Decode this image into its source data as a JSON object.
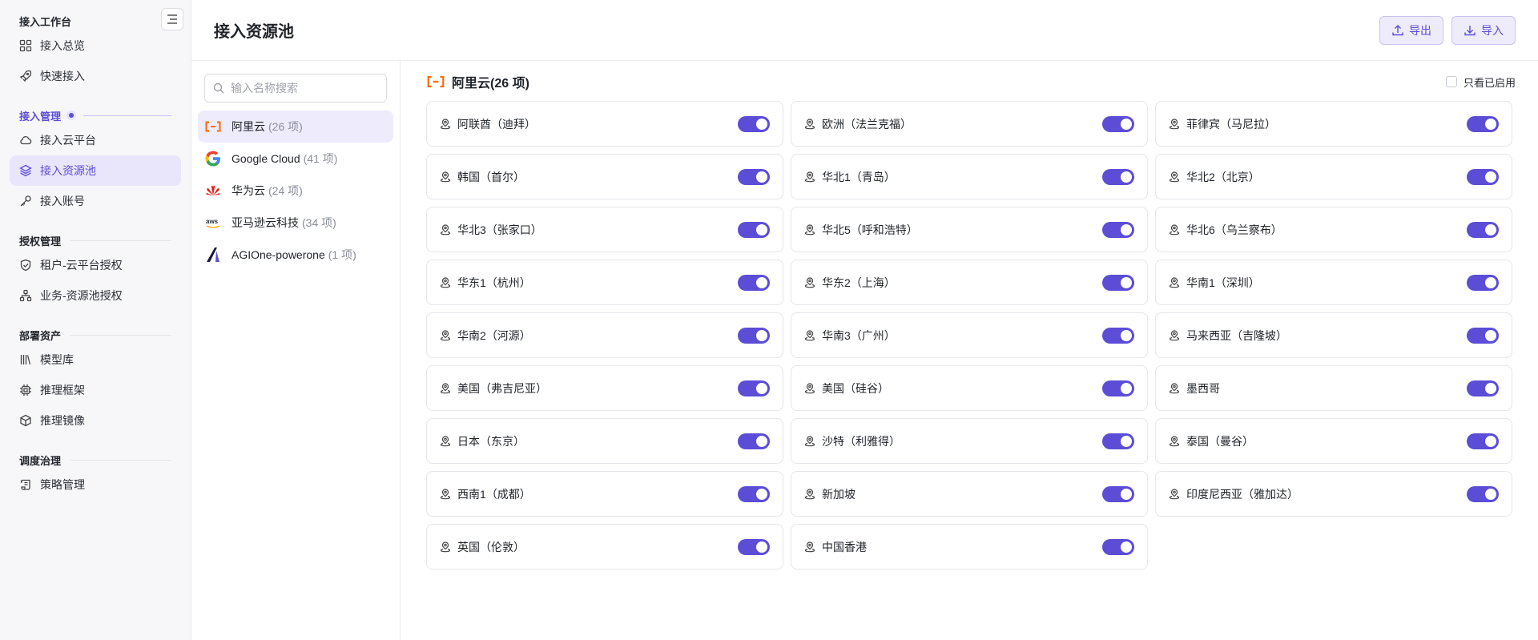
{
  "sidebar": {
    "groups": [
      {
        "title": "接入工作台",
        "items": [
          "接入总览",
          "快速接入"
        ]
      },
      {
        "title": "接入管理",
        "items": [
          "接入云平台",
          "接入资源池",
          "接入账号"
        ]
      },
      {
        "title": "授权管理",
        "items": [
          "租户-云平台授权",
          "业务-资源池授权"
        ]
      },
      {
        "title": "部署资产",
        "items": [
          "模型库",
          "推理框架",
          "推理镜像"
        ]
      },
      {
        "title": "调度治理",
        "items": [
          "策略管理"
        ]
      }
    ]
  },
  "header": {
    "title": "接入资源池",
    "export_label": "导出",
    "import_label": "导入"
  },
  "pool_list": {
    "search_placeholder": "输入名称搜索",
    "pools": [
      {
        "name": "阿里云",
        "count": "(26 项)"
      },
      {
        "name": "Google Cloud",
        "count": "(41 项)"
      },
      {
        "name": "华为云",
        "count": "(24 项)"
      },
      {
        "name": "亚马逊云科技",
        "count": "(34 项)"
      },
      {
        "name": "AGIOne-powerone",
        "count": "(1 项)"
      }
    ]
  },
  "regions": {
    "title": "阿里云(26 项)",
    "only_enabled_label": "只看已启用",
    "items": [
      "阿联酋（迪拜）",
      "欧洲（法兰克福）",
      "菲律宾（马尼拉）",
      "韩国（首尔）",
      "华北1（青岛）",
      "华北2（北京）",
      "华北3（张家口）",
      "华北5（呼和浩特）",
      "华北6（乌兰察布）",
      "华东1（杭州）",
      "华东2（上海）",
      "华南1（深圳）",
      "华南2（河源）",
      "华南3（广州）",
      "马来西亚（吉隆坡）",
      "美国（弗吉尼亚）",
      "美国（硅谷）",
      "墨西哥",
      "日本（东京）",
      "沙特（利雅得）",
      "泰国（曼谷）",
      "西南1（成都）",
      "新加坡",
      "印度尼西亚（雅加达）",
      "英国（伦敦）",
      "中国香港"
    ]
  },
  "colors": {
    "accent": "#5b4dd6",
    "aliyun": "#ff6a00"
  }
}
